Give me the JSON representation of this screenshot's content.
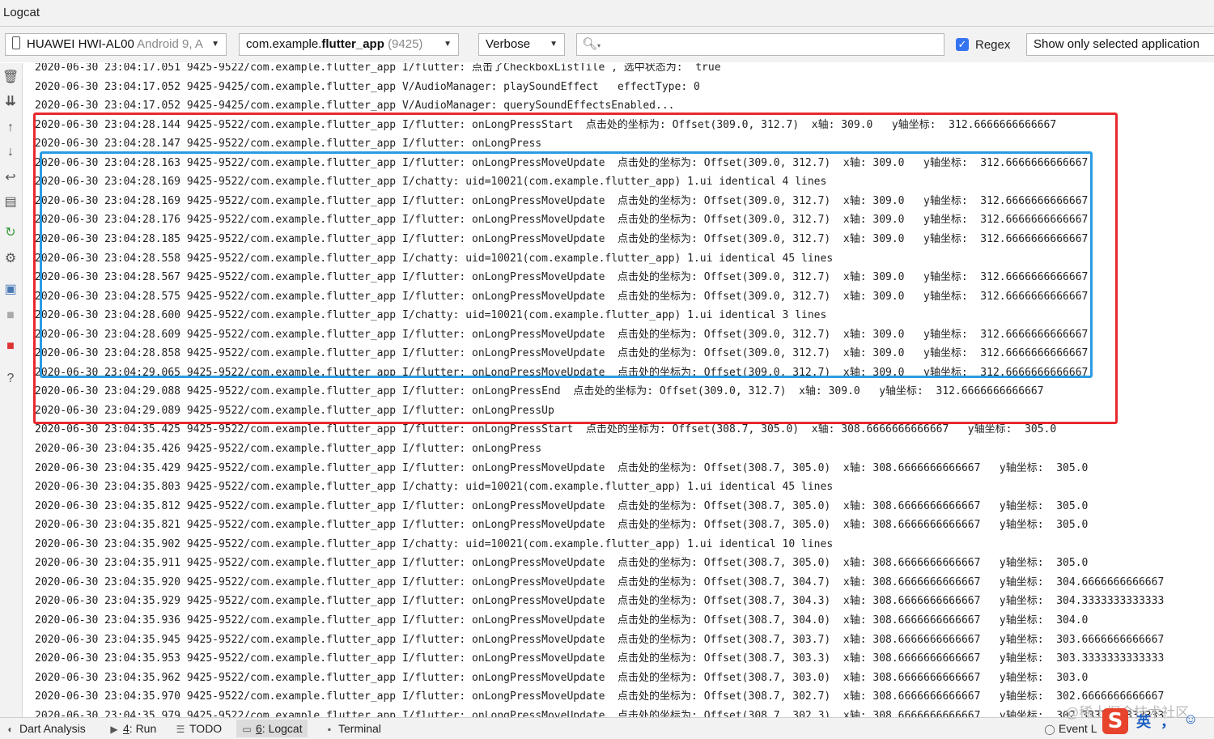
{
  "window": {
    "title": "Logcat"
  },
  "toolbar": {
    "device": {
      "name": "HUAWEI HWI-AL00",
      "detail": "Android 9, A"
    },
    "process": {
      "name_prefix": "com.example.",
      "name_bold": "flutter_app",
      "pid": "(9425)"
    },
    "log_level": "Verbose",
    "search": {
      "value": "",
      "icon": "search-icon"
    },
    "regex": {
      "label": "Regex",
      "checked": true
    },
    "filter": "Show only selected application"
  },
  "sidebar": {
    "icons": [
      "trash-icon",
      "scroll-to-end-icon",
      "up-arrow-icon",
      "down-arrow-icon",
      "soft-wrap-icon",
      "print-icon",
      "restart-icon",
      "settings-icon",
      "screenshot-icon",
      "screen-record-icon",
      "stop-icon",
      "help-icon"
    ]
  },
  "log_lines": [
    "2020-06-30 23:04:17.051 9425-9522/com.example.flutter_app I/flutter: 点击了CheckboxListTile , 选中状态为:  true",
    "2020-06-30 23:04:17.052 9425-9425/com.example.flutter_app V/AudioManager: playSoundEffect   effectType: 0",
    "2020-06-30 23:04:17.052 9425-9425/com.example.flutter_app V/AudioManager: querySoundEffectsEnabled...",
    "2020-06-30 23:04:28.144 9425-9522/com.example.flutter_app I/flutter: onLongPressStart  点击处的坐标为: Offset(309.0, 312.7)  x轴: 309.0   y轴坐标:  312.6666666666667",
    "2020-06-30 23:04:28.147 9425-9522/com.example.flutter_app I/flutter: onLongPress",
    "2020-06-30 23:04:28.163 9425-9522/com.example.flutter_app I/flutter: onLongPressMoveUpdate  点击处的坐标为: Offset(309.0, 312.7)  x轴: 309.0   y轴坐标:  312.6666666666667",
    "2020-06-30 23:04:28.169 9425-9522/com.example.flutter_app I/chatty: uid=10021(com.example.flutter_app) 1.ui identical 4 lines",
    "2020-06-30 23:04:28.169 9425-9522/com.example.flutter_app I/flutter: onLongPressMoveUpdate  点击处的坐标为: Offset(309.0, 312.7)  x轴: 309.0   y轴坐标:  312.6666666666667",
    "2020-06-30 23:04:28.176 9425-9522/com.example.flutter_app I/flutter: onLongPressMoveUpdate  点击处的坐标为: Offset(309.0, 312.7)  x轴: 309.0   y轴坐标:  312.6666666666667",
    "2020-06-30 23:04:28.185 9425-9522/com.example.flutter_app I/flutter: onLongPressMoveUpdate  点击处的坐标为: Offset(309.0, 312.7)  x轴: 309.0   y轴坐标:  312.6666666666667",
    "2020-06-30 23:04:28.558 9425-9522/com.example.flutter_app I/chatty: uid=10021(com.example.flutter_app) 1.ui identical 45 lines",
    "2020-06-30 23:04:28.567 9425-9522/com.example.flutter_app I/flutter: onLongPressMoveUpdate  点击处的坐标为: Offset(309.0, 312.7)  x轴: 309.0   y轴坐标:  312.6666666666667",
    "2020-06-30 23:04:28.575 9425-9522/com.example.flutter_app I/flutter: onLongPressMoveUpdate  点击处的坐标为: Offset(309.0, 312.7)  x轴: 309.0   y轴坐标:  312.6666666666667",
    "2020-06-30 23:04:28.600 9425-9522/com.example.flutter_app I/chatty: uid=10021(com.example.flutter_app) 1.ui identical 3 lines",
    "2020-06-30 23:04:28.609 9425-9522/com.example.flutter_app I/flutter: onLongPressMoveUpdate  点击处的坐标为: Offset(309.0, 312.7)  x轴: 309.0   y轴坐标:  312.6666666666667",
    "2020-06-30 23:04:28.858 9425-9522/com.example.flutter_app I/flutter: onLongPressMoveUpdate  点击处的坐标为: Offset(309.0, 312.7)  x轴: 309.0   y轴坐标:  312.6666666666667",
    "2020-06-30 23:04:29.065 9425-9522/com.example.flutter_app I/flutter: onLongPressMoveUpdate  点击处的坐标为: Offset(309.0, 312.7)  x轴: 309.0   y轴坐标:  312.6666666666667",
    "2020-06-30 23:04:29.088 9425-9522/com.example.flutter_app I/flutter: onLongPressEnd  点击处的坐标为: Offset(309.0, 312.7)  x轴: 309.0   y轴坐标:  312.6666666666667",
    "2020-06-30 23:04:29.089 9425-9522/com.example.flutter_app I/flutter: onLongPressUp",
    "2020-06-30 23:04:35.425 9425-9522/com.example.flutter_app I/flutter: onLongPressStart  点击处的坐标为: Offset(308.7, 305.0)  x轴: 308.6666666666667   y轴坐标:  305.0",
    "2020-06-30 23:04:35.426 9425-9522/com.example.flutter_app I/flutter: onLongPress",
    "2020-06-30 23:04:35.429 9425-9522/com.example.flutter_app I/flutter: onLongPressMoveUpdate  点击处的坐标为: Offset(308.7, 305.0)  x轴: 308.6666666666667   y轴坐标:  305.0",
    "2020-06-30 23:04:35.803 9425-9522/com.example.flutter_app I/chatty: uid=10021(com.example.flutter_app) 1.ui identical 45 lines",
    "2020-06-30 23:04:35.812 9425-9522/com.example.flutter_app I/flutter: onLongPressMoveUpdate  点击处的坐标为: Offset(308.7, 305.0)  x轴: 308.6666666666667   y轴坐标:  305.0",
    "2020-06-30 23:04:35.821 9425-9522/com.example.flutter_app I/flutter: onLongPressMoveUpdate  点击处的坐标为: Offset(308.7, 305.0)  x轴: 308.6666666666667   y轴坐标:  305.0",
    "2020-06-30 23:04:35.902 9425-9522/com.example.flutter_app I/chatty: uid=10021(com.example.flutter_app) 1.ui identical 10 lines",
    "2020-06-30 23:04:35.911 9425-9522/com.example.flutter_app I/flutter: onLongPressMoveUpdate  点击处的坐标为: Offset(308.7, 305.0)  x轴: 308.6666666666667   y轴坐标:  305.0",
    "2020-06-30 23:04:35.920 9425-9522/com.example.flutter_app I/flutter: onLongPressMoveUpdate  点击处的坐标为: Offset(308.7, 304.7)  x轴: 308.6666666666667   y轴坐标:  304.6666666666667",
    "2020-06-30 23:04:35.929 9425-9522/com.example.flutter_app I/flutter: onLongPressMoveUpdate  点击处的坐标为: Offset(308.7, 304.3)  x轴: 308.6666666666667   y轴坐标:  304.3333333333333",
    "2020-06-30 23:04:35.936 9425-9522/com.example.flutter_app I/flutter: onLongPressMoveUpdate  点击处的坐标为: Offset(308.7, 304.0)  x轴: 308.6666666666667   y轴坐标:  304.0",
    "2020-06-30 23:04:35.945 9425-9522/com.example.flutter_app I/flutter: onLongPressMoveUpdate  点击处的坐标为: Offset(308.7, 303.7)  x轴: 308.6666666666667   y轴坐标:  303.6666666666667",
    "2020-06-30 23:04:35.953 9425-9522/com.example.flutter_app I/flutter: onLongPressMoveUpdate  点击处的坐标为: Offset(308.7, 303.3)  x轴: 308.6666666666667   y轴坐标:  303.3333333333333",
    "2020-06-30 23:04:35.962 9425-9522/com.example.flutter_app I/flutter: onLongPressMoveUpdate  点击处的坐标为: Offset(308.7, 303.0)  x轴: 308.6666666666667   y轴坐标:  303.0",
    "2020-06-30 23:04:35.970 9425-9522/com.example.flutter_app I/flutter: onLongPressMoveUpdate  点击处的坐标为: Offset(308.7, 302.7)  x轴: 308.6666666666667   y轴坐标:  302.6666666666667",
    "2020-06-30 23:04:35.979 9425-9522/com.example.flutter_app I/flutter: onLongPressMoveUpdate  点击处的坐标为: Offset(308.7, 302.3)  x轴: 308.6666666666667   y轴坐标:  302.3333333333333"
  ],
  "highlight_colors": {
    "red": "#e8292f",
    "blue": "#2b9be3"
  },
  "statusbar": {
    "tabs": [
      {
        "icon": "dart-analysis-icon",
        "label": "Dart Analysis"
      },
      {
        "icon": "run-icon",
        "num": "4",
        "label": ": Run"
      },
      {
        "icon": "todo-icon",
        "label": "TODO"
      },
      {
        "icon": "logcat-icon",
        "num": "6",
        "label": ": Logcat",
        "selected": true
      },
      {
        "icon": "terminal-icon",
        "label": "Terminal"
      }
    ],
    "event_log": "Event L"
  },
  "watermark": "@稀土掘金技术社区",
  "ime": {
    "logo": "S",
    "lang": "英",
    "punct": "，",
    "emoji": "☺"
  }
}
